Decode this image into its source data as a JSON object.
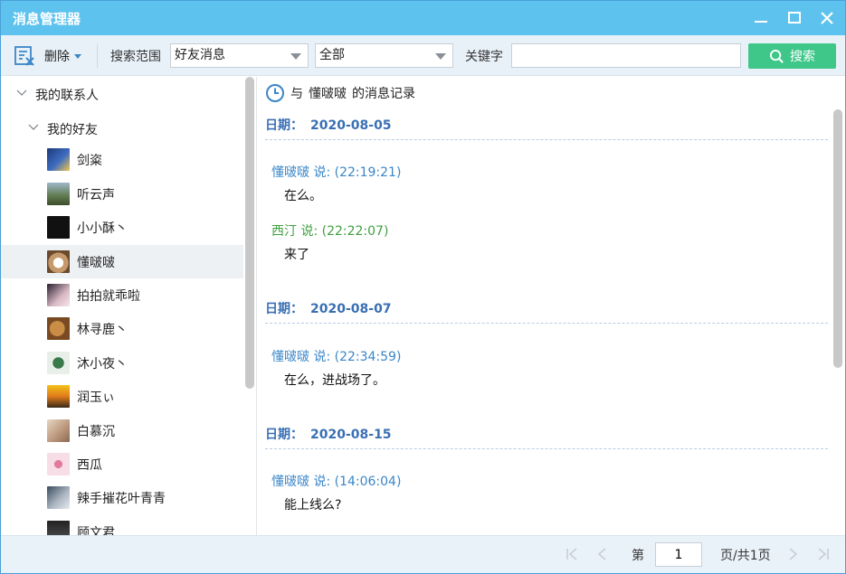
{
  "window": {
    "title": "消息管理器"
  },
  "toolbar": {
    "delete_label": "删除",
    "scope_label": "搜索范围",
    "scope_value": "好友消息",
    "range_value": "全部",
    "keyword_label": "关键字",
    "keyword_value": "",
    "search_label": "搜索"
  },
  "sidebar": {
    "root_label": "我的联系人",
    "group_label": "我的好友",
    "contacts": [
      {
        "name": "剑粢"
      },
      {
        "name": "听云声"
      },
      {
        "name": "小小酥丶"
      },
      {
        "name": "懂啵啵"
      },
      {
        "name": "拍拍就乖啦"
      },
      {
        "name": "林寻鹿丶"
      },
      {
        "name": "沐小夜丶"
      },
      {
        "name": "润玉ぃ"
      },
      {
        "name": "白慕沉"
      },
      {
        "name": "西瓜"
      },
      {
        "name": "辣手摧花叶青青"
      },
      {
        "name": "顾文君"
      }
    ],
    "selected_contact": "懂啵啵"
  },
  "main": {
    "header_prefix": "与",
    "header_name": "懂啵啵",
    "header_suffix": "的消息记录",
    "groups": [
      {
        "date_label": "日期：",
        "date": "2020-08-05",
        "messages": [
          {
            "sender": "懂啵啵 说: (22:19:21)",
            "text": "在么。"
          },
          {
            "sender": "西汀 说: (22:22:07)",
            "text": "来了"
          }
        ]
      },
      {
        "date_label": "日期：",
        "date": "2020-08-07",
        "messages": [
          {
            "sender": "懂啵啵 说: (22:34:59)",
            "text": "在么，进战场了。"
          }
        ]
      },
      {
        "date_label": "日期：",
        "date": "2020-08-15",
        "messages": [
          {
            "sender": "懂啵啵 说: (14:06:04)",
            "text": "能上线么?"
          }
        ]
      }
    ]
  },
  "footer": {
    "page_prefix": "第",
    "page_value": "1",
    "page_suffix": "页/共1页"
  },
  "colors": {
    "titlebar": "#5ec2ee",
    "search_button": "#3fc78a",
    "date_text": "#3a6fb4",
    "friend_sender": "#3a86c8",
    "self_sender": "#3fa040"
  }
}
